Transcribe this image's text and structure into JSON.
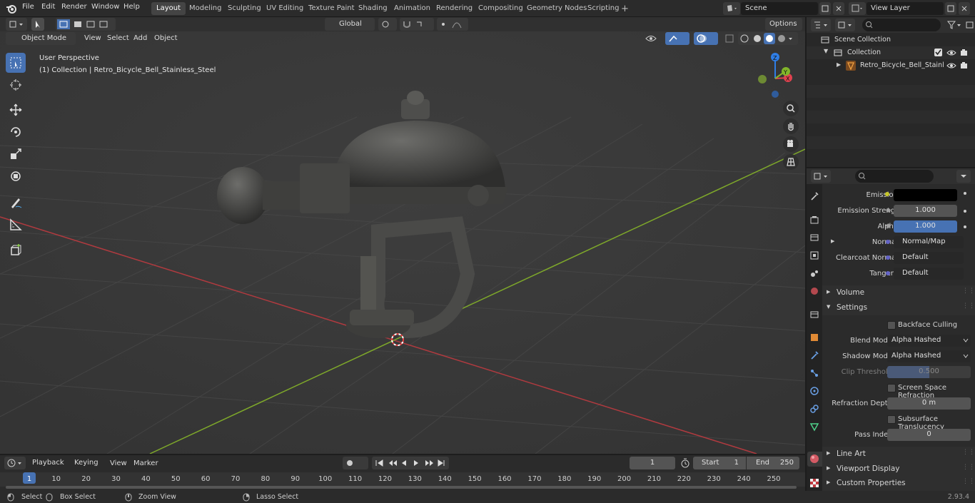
{
  "menu": [
    "File",
    "Edit",
    "Render",
    "Window",
    "Help"
  ],
  "workspaces": [
    "Layout",
    "Modeling",
    "Sculpting",
    "UV Editing",
    "Texture Paint",
    "Shading",
    "Animation",
    "Rendering",
    "Compositing",
    "Geometry Nodes",
    "Scripting"
  ],
  "active_workspace": "Layout",
  "scene": "Scene",
  "view_layer": "View Layer",
  "header": {
    "mode": "Object Mode",
    "view": "View",
    "select": "Select",
    "add": "Add",
    "object": "Object",
    "orientation": "Global",
    "options": "Options"
  },
  "viewport": {
    "perspective": "User Perspective",
    "collection_info": "(1) Collection | Retro_Bicycle_Bell_Stainless_Steel"
  },
  "outliner": {
    "scene_collection": "Scene Collection",
    "collection": "Collection",
    "object": "Retro_Bicycle_Bell_Stainl"
  },
  "properties": {
    "emission": "Emission",
    "emission_strength_label": "Emission Strengt",
    "emission_strength": "1.000",
    "alpha_label": "Alpha",
    "alpha": "1.000",
    "normal_label": "Normal",
    "normal": "Normal/Map",
    "clearcoat_normal_label": "Clearcoat Normal",
    "clearcoat_normal": "Default",
    "tangent_label": "Tangent",
    "tangent": "Default",
    "volume": "Volume",
    "settings": "Settings",
    "backface_culling": "Backface Culling",
    "blend_mode_label": "Blend Mode",
    "blend_mode": "Alpha Hashed",
    "shadow_mode_label": "Shadow Mode",
    "shadow_mode": "Alpha Hashed",
    "clip_threshold_label": "Clip Threshold",
    "clip_threshold": "0.500",
    "screen_space_refraction": "Screen Space Refraction",
    "refraction_depth_label": "Refraction Depth",
    "refraction_depth": "0 m",
    "subsurface_translucency": "Subsurface Translucency",
    "pass_index_label": "Pass Index",
    "pass_index": "0",
    "line_art": "Line Art",
    "viewport_display": "Viewport Display",
    "custom_properties": "Custom Properties"
  },
  "timeline": {
    "playback": "Playback",
    "keying": "Keying",
    "view": "View",
    "marker": "Marker",
    "current_frame": "1",
    "start_label": "Start",
    "start": "1",
    "end_label": "End",
    "end": "250",
    "ticks": [
      "1",
      "10",
      "20",
      "30",
      "40",
      "50",
      "60",
      "70",
      "80",
      "90",
      "100",
      "110",
      "120",
      "130",
      "140",
      "150",
      "160",
      "170",
      "180",
      "190",
      "200",
      "210",
      "220",
      "230",
      "240",
      "250"
    ]
  },
  "status": {
    "select": "Select",
    "box_select": "Box Select",
    "zoom_view": "Zoom View",
    "lasso_select": "Lasso Select",
    "version": "2.93.4"
  },
  "colors": {
    "accent": "#4772b3",
    "x_axis": "#c0393f",
    "y_axis": "#7ea82a",
    "gizmo_z": "#2f7ee6",
    "gizmo_x": "#e0424f",
    "gizmo_y": "#82b52a"
  }
}
